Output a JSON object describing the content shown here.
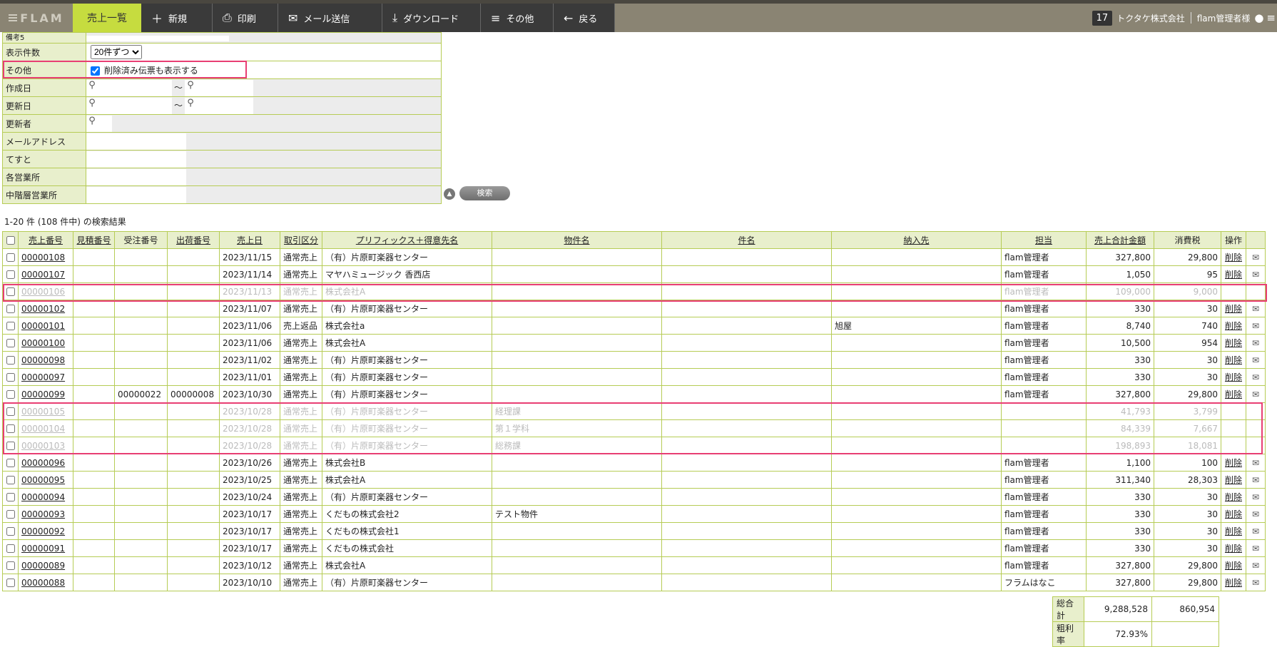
{
  "header": {
    "logo": "FLAM",
    "active_tab": "売上一覧",
    "buttons": [
      {
        "label": "新規",
        "icon": "plus-icon"
      },
      {
        "label": "印刷",
        "icon": "printer-icon"
      },
      {
        "label": "メール送信",
        "icon": "mail-icon"
      },
      {
        "label": "ダウンロード",
        "icon": "download-icon"
      },
      {
        "label": "その他",
        "icon": "menu-lines-icon"
      },
      {
        "label": "戻る",
        "icon": "arrow-left-icon"
      }
    ],
    "count_badge": "17",
    "company": "トクタケ株式会社",
    "user": "flam管理者様"
  },
  "form": {
    "biko5_label": "備考5",
    "display_count_label": "表示件数",
    "display_count_value": "20件ずつ",
    "other_label": "その他",
    "show_deleted_label": "削除済み伝票も表示する",
    "created_label": "作成日",
    "updated_label": "更新日",
    "updater_label": "更新者",
    "email_label": "メールアドレス",
    "test_label": "てすと",
    "branch_label": "各営業所",
    "mid_branch_label": "中階層営業所",
    "range_sep": "～",
    "search_button": "検索"
  },
  "result_info": "1-20 件 (108 件中) の検索結果",
  "table": {
    "headers": [
      "売上番号",
      "見積番号",
      "受注番号",
      "出荷番号",
      "売上日",
      "取引区分",
      "プリフィックス＋得意先名",
      "物件名",
      "件名",
      "納入先",
      "担当",
      "売上合計金額",
      "消費税",
      "操作"
    ],
    "delete_label": "削除",
    "rows": [
      {
        "no": "00000108",
        "est": "",
        "ord": "",
        "ship": "",
        "date": "2023/11/15",
        "kind": "通常売上",
        "client": "（有）片原町楽器センター",
        "prop": "",
        "subj": "",
        "dest": "",
        "staff": "flam管理者",
        "total": "327,800",
        "tax": "29,800",
        "deleted": false
      },
      {
        "no": "00000107",
        "est": "",
        "ord": "",
        "ship": "",
        "date": "2023/11/14",
        "kind": "通常売上",
        "client": "マヤハミュージック 香西店",
        "prop": "",
        "subj": "",
        "dest": "",
        "staff": "flam管理者",
        "total": "1,050",
        "tax": "95",
        "deleted": false
      },
      {
        "no": "00000106",
        "est": "",
        "ord": "",
        "ship": "",
        "date": "2023/11/13",
        "kind": "通常売上",
        "client": "株式会社A",
        "prop": "",
        "subj": "",
        "dest": "",
        "staff": "flam管理者",
        "total": "109,000",
        "tax": "9,000",
        "deleted": true
      },
      {
        "no": "00000102",
        "est": "",
        "ord": "",
        "ship": "",
        "date": "2023/11/07",
        "kind": "通常売上",
        "client": "（有）片原町楽器センター",
        "prop": "",
        "subj": "",
        "dest": "",
        "staff": "flam管理者",
        "total": "330",
        "tax": "30",
        "deleted": false
      },
      {
        "no": "00000101",
        "est": "",
        "ord": "",
        "ship": "",
        "date": "2023/11/06",
        "kind": "売上返品",
        "client": "株式会社a",
        "prop": "",
        "subj": "",
        "dest": "旭屋",
        "staff": "flam管理者",
        "total": "8,740",
        "tax": "740",
        "deleted": false
      },
      {
        "no": "00000100",
        "est": "",
        "ord": "",
        "ship": "",
        "date": "2023/11/06",
        "kind": "通常売上",
        "client": "株式会社A",
        "prop": "",
        "subj": "",
        "dest": "",
        "staff": "flam管理者",
        "total": "10,500",
        "tax": "954",
        "deleted": false
      },
      {
        "no": "00000098",
        "est": "",
        "ord": "",
        "ship": "",
        "date": "2023/11/02",
        "kind": "通常売上",
        "client": "（有）片原町楽器センター",
        "prop": "",
        "subj": "",
        "dest": "",
        "staff": "flam管理者",
        "total": "330",
        "tax": "30",
        "deleted": false
      },
      {
        "no": "00000097",
        "est": "",
        "ord": "",
        "ship": "",
        "date": "2023/11/01",
        "kind": "通常売上",
        "client": "（有）片原町楽器センター",
        "prop": "",
        "subj": "",
        "dest": "",
        "staff": "flam管理者",
        "total": "330",
        "tax": "30",
        "deleted": false
      },
      {
        "no": "00000099",
        "est": "",
        "ord": "00000022",
        "ship": "00000008",
        "date": "2023/10/30",
        "kind": "通常売上",
        "client": "（有）片原町楽器センター",
        "prop": "",
        "subj": "",
        "dest": "",
        "staff": "flam管理者",
        "total": "327,800",
        "tax": "29,800",
        "deleted": false
      },
      {
        "no": "00000105",
        "est": "",
        "ord": "",
        "ship": "",
        "date": "2023/10/28",
        "kind": "通常売上",
        "client": "（有）片原町楽器センター",
        "prop": "経理課",
        "subj": "",
        "dest": "",
        "staff": "",
        "total": "41,793",
        "tax": "3,799",
        "deleted": true
      },
      {
        "no": "00000104",
        "est": "",
        "ord": "",
        "ship": "",
        "date": "2023/10/28",
        "kind": "通常売上",
        "client": "（有）片原町楽器センター",
        "prop": "第１学科",
        "subj": "",
        "dest": "",
        "staff": "",
        "total": "84,339",
        "tax": "7,667",
        "deleted": true
      },
      {
        "no": "00000103",
        "est": "",
        "ord": "",
        "ship": "",
        "date": "2023/10/28",
        "kind": "通常売上",
        "client": "（有）片原町楽器センター",
        "prop": "総務課",
        "subj": "",
        "dest": "",
        "staff": "",
        "total": "198,893",
        "tax": "18,081",
        "deleted": true
      },
      {
        "no": "00000096",
        "est": "",
        "ord": "",
        "ship": "",
        "date": "2023/10/26",
        "kind": "通常売上",
        "client": "株式会社B",
        "prop": "",
        "subj": "",
        "dest": "",
        "staff": "flam管理者",
        "total": "1,100",
        "tax": "100",
        "deleted": false
      },
      {
        "no": "00000095",
        "est": "",
        "ord": "",
        "ship": "",
        "date": "2023/10/25",
        "kind": "通常売上",
        "client": "株式会社A",
        "prop": "",
        "subj": "",
        "dest": "",
        "staff": "flam管理者",
        "total": "311,340",
        "tax": "28,303",
        "deleted": false
      },
      {
        "no": "00000094",
        "est": "",
        "ord": "",
        "ship": "",
        "date": "2023/10/24",
        "kind": "通常売上",
        "client": "（有）片原町楽器センター",
        "prop": "",
        "subj": "",
        "dest": "",
        "staff": "flam管理者",
        "total": "330",
        "tax": "30",
        "deleted": false
      },
      {
        "no": "00000093",
        "est": "",
        "ord": "",
        "ship": "",
        "date": "2023/10/17",
        "kind": "通常売上",
        "client": "くだもの株式会社2",
        "prop": "テスト物件",
        "subj": "",
        "dest": "",
        "staff": "flam管理者",
        "total": "330",
        "tax": "30",
        "deleted": false
      },
      {
        "no": "00000092",
        "est": "",
        "ord": "",
        "ship": "",
        "date": "2023/10/17",
        "kind": "通常売上",
        "client": "くだもの株式会社1",
        "prop": "",
        "subj": "",
        "dest": "",
        "staff": "flam管理者",
        "total": "330",
        "tax": "30",
        "deleted": false
      },
      {
        "no": "00000091",
        "est": "",
        "ord": "",
        "ship": "",
        "date": "2023/10/17",
        "kind": "通常売上",
        "client": "くだもの株式会社",
        "prop": "",
        "subj": "",
        "dest": "",
        "staff": "flam管理者",
        "total": "330",
        "tax": "30",
        "deleted": false
      },
      {
        "no": "00000089",
        "est": "",
        "ord": "",
        "ship": "",
        "date": "2023/10/12",
        "kind": "通常売上",
        "client": "株式会社A",
        "prop": "",
        "subj": "",
        "dest": "",
        "staff": "flam管理者",
        "total": "327,800",
        "tax": "29,800",
        "deleted": false
      },
      {
        "no": "00000088",
        "est": "",
        "ord": "",
        "ship": "",
        "date": "2023/10/10",
        "kind": "通常売上",
        "client": "（有）片原町楽器センター",
        "prop": "",
        "subj": "",
        "dest": "",
        "staff": "フラムはなこ",
        "total": "327,800",
        "tax": "29,800",
        "deleted": false
      }
    ]
  },
  "totals": {
    "grand_total_label": "総合計",
    "grand_total": "9,288,528",
    "grand_tax": "860,954",
    "margin_label": "粗利率",
    "margin": "72.93%"
  },
  "colors": {
    "accent_tab": "#c6dc3f",
    "highlight": "#e83e73",
    "label_bg": "#e8efcc",
    "border": "#b6cc55"
  }
}
